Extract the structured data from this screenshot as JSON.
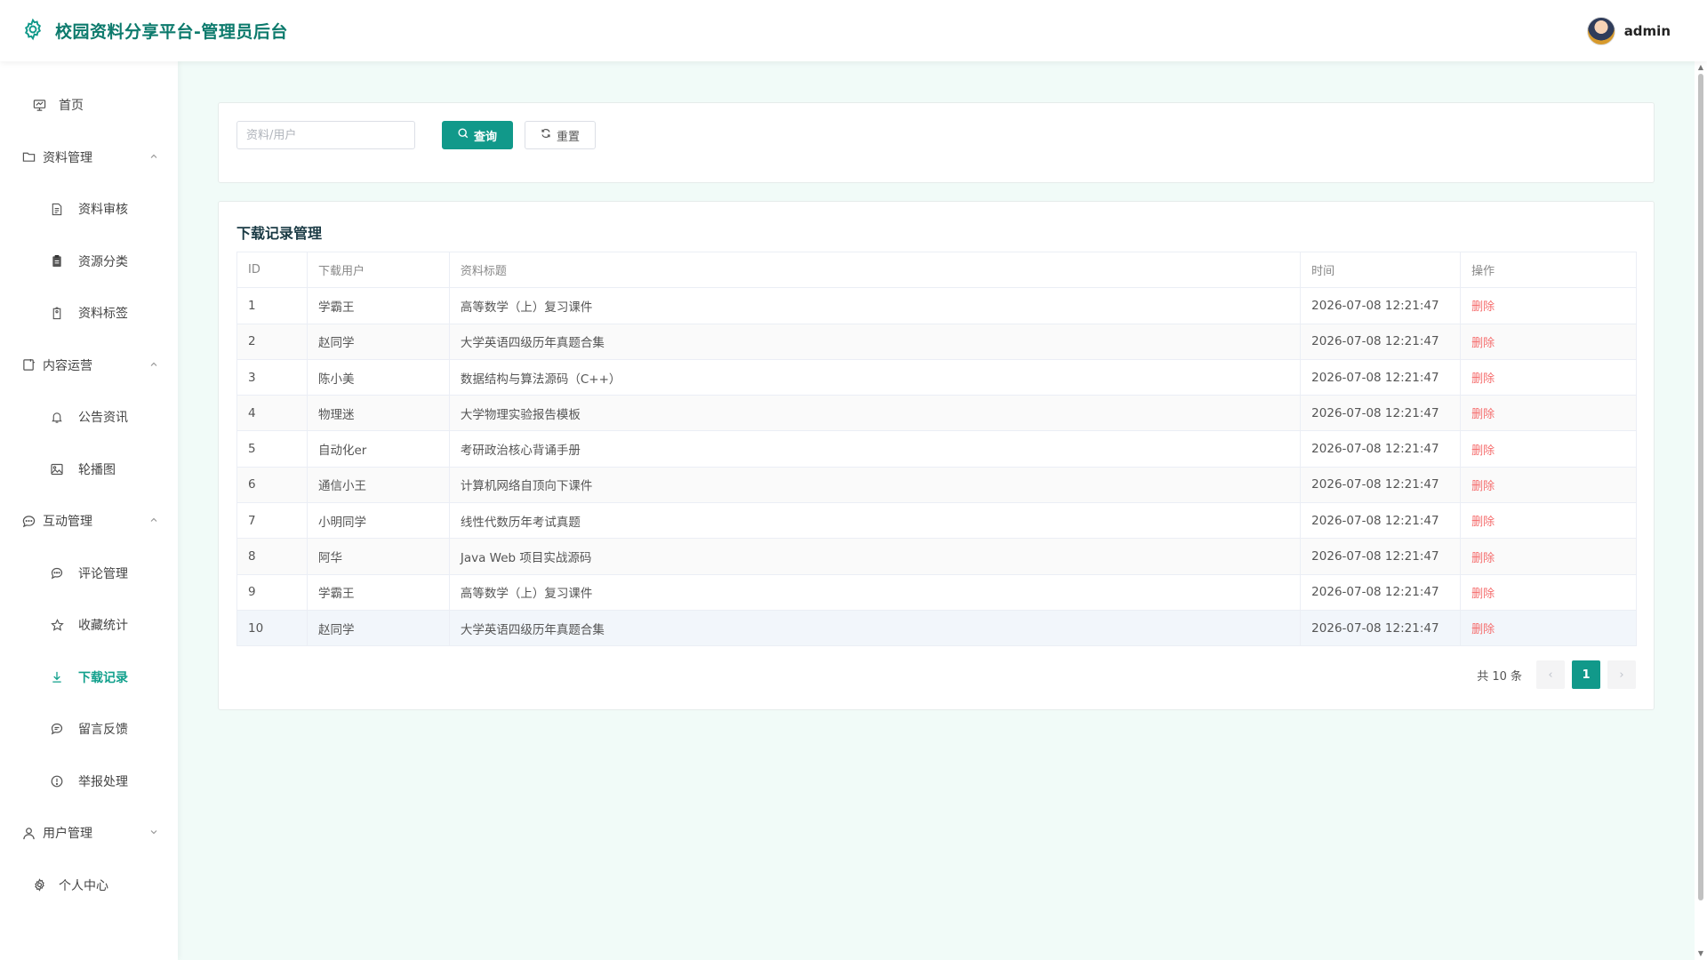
{
  "header": {
    "title": "校园资料分享平台-管理员后台",
    "username": "admin"
  },
  "sidebar": {
    "home": "首页",
    "groups": [
      {
        "label": "资料管理",
        "expanded": true,
        "items": [
          "资料审核",
          "资源分类",
          "资料标签"
        ]
      },
      {
        "label": "内容运营",
        "expanded": true,
        "items": [
          "公告资讯",
          "轮播图"
        ]
      },
      {
        "label": "互动管理",
        "expanded": true,
        "items": [
          "评论管理",
          "收藏统计",
          "下载记录",
          "留言反馈",
          "举报处理"
        ]
      },
      {
        "label": "用户管理",
        "expanded": false,
        "items": []
      }
    ],
    "personal": "个人中心",
    "active": "下载记录"
  },
  "search": {
    "placeholder": "资料/用户",
    "value": "",
    "query_label": "查询",
    "reset_label": "重置"
  },
  "table": {
    "title": "下载记录管理",
    "columns": [
      "ID",
      "下载用户",
      "资料标题",
      "时间",
      "操作"
    ],
    "rows": [
      {
        "id": "1",
        "user": "学霸王",
        "title": "高等数学（上）复习课件",
        "time": "2026-07-08 12:21:47",
        "action": "删除"
      },
      {
        "id": "2",
        "user": "赵同学",
        "title": "大学英语四级历年真题合集",
        "time": "2026-07-08 12:21:47",
        "action": "删除"
      },
      {
        "id": "3",
        "user": "陈小美",
        "title": "数据结构与算法源码（C++）",
        "time": "2026-07-08 12:21:47",
        "action": "删除"
      },
      {
        "id": "4",
        "user": "物理迷",
        "title": "大学物理实验报告模板",
        "time": "2026-07-08 12:21:47",
        "action": "删除"
      },
      {
        "id": "5",
        "user": "自动化er",
        "title": "考研政治核心背诵手册",
        "time": "2026-07-08 12:21:47",
        "action": "删除"
      },
      {
        "id": "6",
        "user": "通信小王",
        "title": "计算机网络自顶向下课件",
        "time": "2026-07-08 12:21:47",
        "action": "删除"
      },
      {
        "id": "7",
        "user": "小明同学",
        "title": "线性代数历年考试真题",
        "time": "2026-07-08 12:21:47",
        "action": "删除"
      },
      {
        "id": "8",
        "user": "阿华",
        "title": "Java Web 项目实战源码",
        "time": "2026-07-08 12:21:47",
        "action": "删除"
      },
      {
        "id": "9",
        "user": "学霸王",
        "title": "高等数学（上）复习课件",
        "time": "2026-07-08 12:21:47",
        "action": "删除"
      },
      {
        "id": "10",
        "user": "赵同学",
        "title": "大学英语四级历年真题合集",
        "time": "2026-07-08 12:21:47",
        "action": "删除"
      }
    ]
  },
  "pagination": {
    "total_label": "共 10 条",
    "current_page": "1",
    "prev": "‹",
    "next": "›"
  },
  "colors": {
    "brand": "#0c7a6c",
    "primary": "#11998a",
    "danger": "#f56c6c",
    "background": "#f1fbf8"
  }
}
